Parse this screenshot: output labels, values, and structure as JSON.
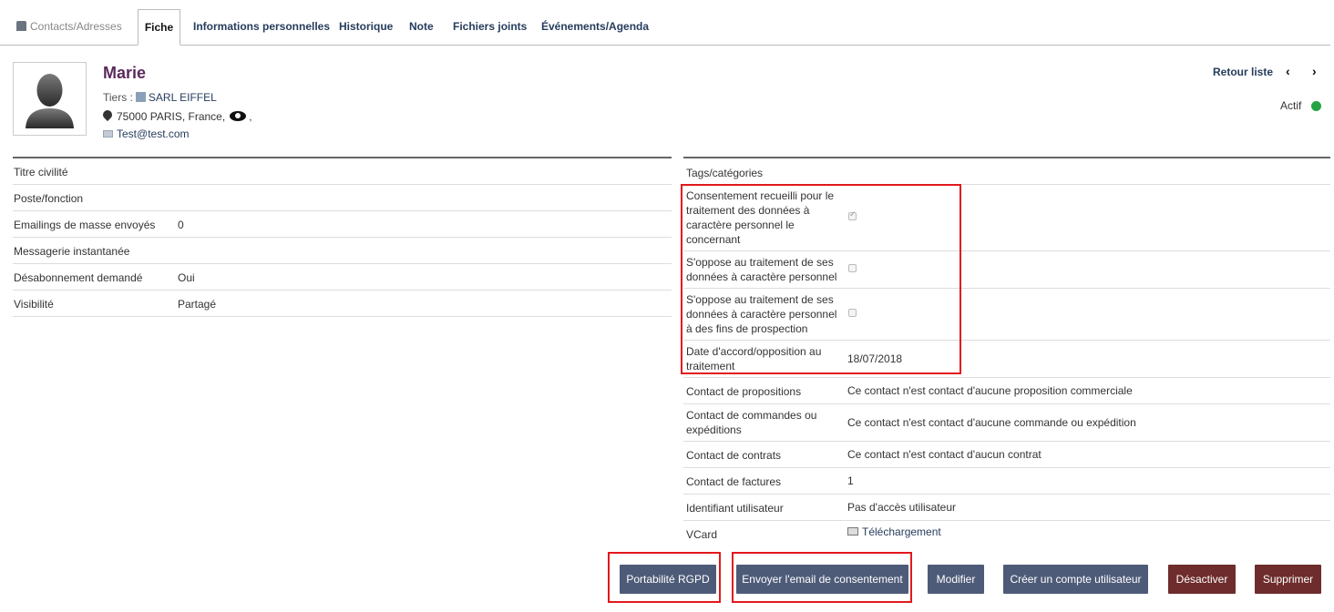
{
  "tabs": {
    "contacts": "Contacts/Adresses",
    "fiche": "Fiche",
    "infos": "Informations personnelles",
    "historique": "Historique",
    "note": "Note",
    "fichiers": "Fichiers joints",
    "evenements": "Événements/Agenda"
  },
  "header": {
    "name": "Marie",
    "tiers_label": "Tiers :",
    "tiers_value": "SARL EIFFEL",
    "address": "75000 PARIS, France,",
    "address_suffix": ",",
    "email": "Test@test.com",
    "retour": "Retour liste",
    "prev": "‹",
    "next": "›",
    "status": "Actif",
    "status_color": "#25a344"
  },
  "left": {
    "titre_label": "Titre civilité",
    "poste_label": "Poste/fonction",
    "emailings_label": "Emailings de masse envoyés",
    "emailings_value": "0",
    "messagerie_label": "Messagerie instantanée",
    "desabo_label": "Désabonnement demandé",
    "desabo_value": "Oui",
    "visibilite_label": "Visibilité",
    "visibilite_value": "Partagé"
  },
  "right": {
    "tags_label": "Tags/catégories",
    "consent_label": "Consentement recueilli pour le traitement des données à caractère personnel le concernant",
    "consent_checked": true,
    "oppose_label": "S'oppose au traitement de ses données à caractère personnel",
    "oppose_checked": false,
    "oppose_prosp_label": "S'oppose au traitement de ses données à caractère personnel à des fins de prospection",
    "oppose_prosp_checked": false,
    "date_label": "Date d'accord/opposition au traitement",
    "date_value": "18/07/2018",
    "propositions_label": "Contact de propositions",
    "propositions_value": "Ce contact n'est contact d'aucune proposition commerciale",
    "commandes_label": "Contact de commandes ou expéditions",
    "commandes_value": "Ce contact n'est contact d'aucune commande ou expédition",
    "contrats_label": "Contact de contrats",
    "contrats_value": "Ce contact n'est contact d'aucun contrat",
    "factures_label": "Contact de factures",
    "factures_value": "1",
    "user_label": "Identifiant utilisateur",
    "user_value": "Pas d'accès utilisateur",
    "vcard_label": "VCard",
    "vcard_value": "Téléchargement"
  },
  "buttons": {
    "portabilite": "Portabilité RGPD",
    "envoyer": "Envoyer l'email de consentement",
    "modifier": "Modifier",
    "creer": "Créer un compte utilisateur",
    "desactiver": "Désactiver",
    "supprimer": "Supprimer"
  },
  "colors": {
    "button_primary": "#4e5b78",
    "button_danger": "#6e2c2c",
    "highlight": "#e3181c",
    "name": "#5b2a5e"
  }
}
